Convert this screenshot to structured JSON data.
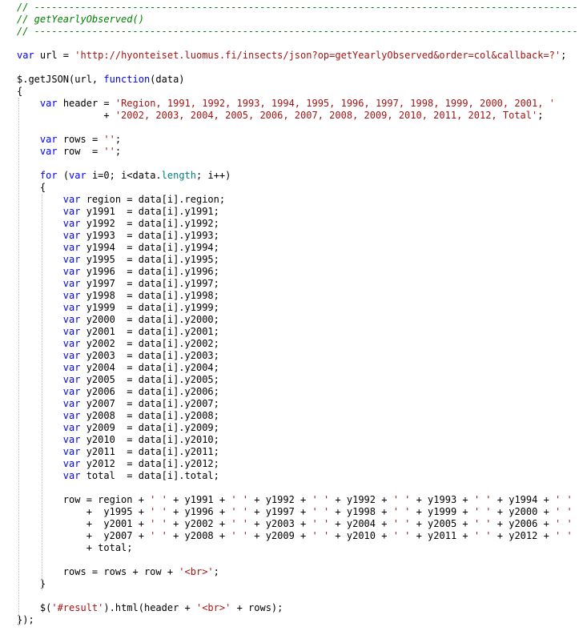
{
  "code": {
    "lines": [
      [
        {
          "t": "// ------------------------------------------------------------------------------------------------",
          "c": "cmt"
        }
      ],
      [
        {
          "t": "// getYearlyObserved()",
          "c": "cmt"
        }
      ],
      [
        {
          "t": "// ------------------------------------------------------------------------------------------------",
          "c": "cmt"
        }
      ],
      [],
      [
        {
          "t": "var",
          "c": "kw"
        },
        {
          "t": " url = "
        },
        {
          "t": "'http://hyonteiset.luomus.fi/insects/json?op=getYearlyObserved&order=col&callback=?'",
          "c": "str"
        },
        {
          "t": ";"
        }
      ],
      [],
      [
        {
          "t": "$.getJSON(url, "
        },
        {
          "t": "function",
          "c": "kw"
        },
        {
          "t": "(data)"
        }
      ],
      [
        {
          "t": "{"
        }
      ],
      [
        {
          "t": "    "
        },
        {
          "t": "var",
          "c": "kw"
        },
        {
          "t": " header = "
        },
        {
          "t": "'Region, 1991, 1992, 1993, 1994, 1995, 1996, 1997, 1998, 1999, 2000, 2001, '",
          "c": "str"
        }
      ],
      [
        {
          "t": "               + "
        },
        {
          "t": "'2002, 2003, 2004, 2005, 2006, 2007, 2008, 2009, 2010, 2011, 2012, Total'",
          "c": "str"
        },
        {
          "t": ";"
        }
      ],
      [],
      [
        {
          "t": "    "
        },
        {
          "t": "var",
          "c": "kw"
        },
        {
          "t": " rows = "
        },
        {
          "t": "''",
          "c": "str"
        },
        {
          "t": ";"
        }
      ],
      [
        {
          "t": "    "
        },
        {
          "t": "var",
          "c": "kw"
        },
        {
          "t": " row  = "
        },
        {
          "t": "''",
          "c": "str"
        },
        {
          "t": ";"
        }
      ],
      [],
      [
        {
          "t": "    "
        },
        {
          "t": "for",
          "c": "kw"
        },
        {
          "t": " ("
        },
        {
          "t": "var",
          "c": "kw"
        },
        {
          "t": " i=0; i<data."
        },
        {
          "t": "length",
          "c": "prop"
        },
        {
          "t": "; i++)"
        }
      ],
      [
        {
          "t": "    {"
        }
      ],
      [
        {
          "t": "        "
        },
        {
          "t": "var",
          "c": "kw"
        },
        {
          "t": " region = data[i].region;"
        }
      ],
      [
        {
          "t": "        "
        },
        {
          "t": "var",
          "c": "kw"
        },
        {
          "t": " y1991  = data[i].y1991;"
        }
      ],
      [
        {
          "t": "        "
        },
        {
          "t": "var",
          "c": "kw"
        },
        {
          "t": " y1992  = data[i].y1992;"
        }
      ],
      [
        {
          "t": "        "
        },
        {
          "t": "var",
          "c": "kw"
        },
        {
          "t": " y1993  = data[i].y1993;"
        }
      ],
      [
        {
          "t": "        "
        },
        {
          "t": "var",
          "c": "kw"
        },
        {
          "t": " y1994  = data[i].y1994;"
        }
      ],
      [
        {
          "t": "        "
        },
        {
          "t": "var",
          "c": "kw"
        },
        {
          "t": " y1995  = data[i].y1995;"
        }
      ],
      [
        {
          "t": "        "
        },
        {
          "t": "var",
          "c": "kw"
        },
        {
          "t": " y1996  = data[i].y1996;"
        }
      ],
      [
        {
          "t": "        "
        },
        {
          "t": "var",
          "c": "kw"
        },
        {
          "t": " y1997  = data[i].y1997;"
        }
      ],
      [
        {
          "t": "        "
        },
        {
          "t": "var",
          "c": "kw"
        },
        {
          "t": " y1998  = data[i].y1998;"
        }
      ],
      [
        {
          "t": "        "
        },
        {
          "t": "var",
          "c": "kw"
        },
        {
          "t": " y1999  = data[i].y1999;"
        }
      ],
      [
        {
          "t": "        "
        },
        {
          "t": "var",
          "c": "kw"
        },
        {
          "t": " y2000  = data[i].y2000;"
        }
      ],
      [
        {
          "t": "        "
        },
        {
          "t": "var",
          "c": "kw"
        },
        {
          "t": " y2001  = data[i].y2001;"
        }
      ],
      [
        {
          "t": "        "
        },
        {
          "t": "var",
          "c": "kw"
        },
        {
          "t": " y2002  = data[i].y2002;"
        }
      ],
      [
        {
          "t": "        "
        },
        {
          "t": "var",
          "c": "kw"
        },
        {
          "t": " y2003  = data[i].y2003;"
        }
      ],
      [
        {
          "t": "        "
        },
        {
          "t": "var",
          "c": "kw"
        },
        {
          "t": " y2004  = data[i].y2004;"
        }
      ],
      [
        {
          "t": "        "
        },
        {
          "t": "var",
          "c": "kw"
        },
        {
          "t": " y2005  = data[i].y2005;"
        }
      ],
      [
        {
          "t": "        "
        },
        {
          "t": "var",
          "c": "kw"
        },
        {
          "t": " y2006  = data[i].y2006;"
        }
      ],
      [
        {
          "t": "        "
        },
        {
          "t": "var",
          "c": "kw"
        },
        {
          "t": " y2007  = data[i].y2007;"
        }
      ],
      [
        {
          "t": "        "
        },
        {
          "t": "var",
          "c": "kw"
        },
        {
          "t": " y2008  = data[i].y2008;"
        }
      ],
      [
        {
          "t": "        "
        },
        {
          "t": "var",
          "c": "kw"
        },
        {
          "t": " y2009  = data[i].y2009;"
        }
      ],
      [
        {
          "t": "        "
        },
        {
          "t": "var",
          "c": "kw"
        },
        {
          "t": " y2010  = data[i].y2010;"
        }
      ],
      [
        {
          "t": "        "
        },
        {
          "t": "var",
          "c": "kw"
        },
        {
          "t": " y2011  = data[i].y2011;"
        }
      ],
      [
        {
          "t": "        "
        },
        {
          "t": "var",
          "c": "kw"
        },
        {
          "t": " y2012  = data[i].y2012;"
        }
      ],
      [
        {
          "t": "        "
        },
        {
          "t": "var",
          "c": "kw"
        },
        {
          "t": " total  = data[i].total;"
        }
      ],
      [],
      [
        {
          "t": "        row = region + "
        },
        {
          "t": "' '",
          "c": "str"
        },
        {
          "t": " + y1991 + "
        },
        {
          "t": "' '",
          "c": "str"
        },
        {
          "t": " + y1992 + "
        },
        {
          "t": "' '",
          "c": "str"
        },
        {
          "t": " + y1992 + "
        },
        {
          "t": "' '",
          "c": "str"
        },
        {
          "t": " + y1993 + "
        },
        {
          "t": "' '",
          "c": "str"
        },
        {
          "t": " + y1994 + "
        },
        {
          "t": "' '",
          "c": "str"
        }
      ],
      [
        {
          "t": "            +  y1995 + "
        },
        {
          "t": "' '",
          "c": "str"
        },
        {
          "t": " + y1996 + "
        },
        {
          "t": "' '",
          "c": "str"
        },
        {
          "t": " + y1997 + "
        },
        {
          "t": "' '",
          "c": "str"
        },
        {
          "t": " + y1998 + "
        },
        {
          "t": "' '",
          "c": "str"
        },
        {
          "t": " + y1999 + "
        },
        {
          "t": "' '",
          "c": "str"
        },
        {
          "t": " + y2000 + "
        },
        {
          "t": "' '",
          "c": "str"
        }
      ],
      [
        {
          "t": "            +  y2001 + "
        },
        {
          "t": "' '",
          "c": "str"
        },
        {
          "t": " + y2002 + "
        },
        {
          "t": "' '",
          "c": "str"
        },
        {
          "t": " + y2003 + "
        },
        {
          "t": "' '",
          "c": "str"
        },
        {
          "t": " + y2004 + "
        },
        {
          "t": "' '",
          "c": "str"
        },
        {
          "t": " + y2005 + "
        },
        {
          "t": "' '",
          "c": "str"
        },
        {
          "t": " + y2006 + "
        },
        {
          "t": "' '",
          "c": "str"
        }
      ],
      [
        {
          "t": "            +  y2007 + "
        },
        {
          "t": "' '",
          "c": "str"
        },
        {
          "t": " + y2008 + "
        },
        {
          "t": "' '",
          "c": "str"
        },
        {
          "t": " + y2009 + "
        },
        {
          "t": "' '",
          "c": "str"
        },
        {
          "t": " + y2010 + "
        },
        {
          "t": "' '",
          "c": "str"
        },
        {
          "t": " + y2011 + "
        },
        {
          "t": "' '",
          "c": "str"
        },
        {
          "t": " + y2012 + "
        },
        {
          "t": "' '",
          "c": "str"
        }
      ],
      [
        {
          "t": "            + total;"
        }
      ],
      [],
      [
        {
          "t": "        rows = rows + row + "
        },
        {
          "t": "'<br>'",
          "c": "str"
        },
        {
          "t": ";"
        }
      ],
      [
        {
          "t": "    }"
        }
      ],
      [],
      [
        {
          "t": "    $("
        },
        {
          "t": "'#result'",
          "c": "str"
        },
        {
          "t": ").html(header + "
        },
        {
          "t": "'<br>'",
          "c": "str"
        },
        {
          "t": " + rows);"
        }
      ],
      [
        {
          "t": "});"
        }
      ]
    ]
  }
}
